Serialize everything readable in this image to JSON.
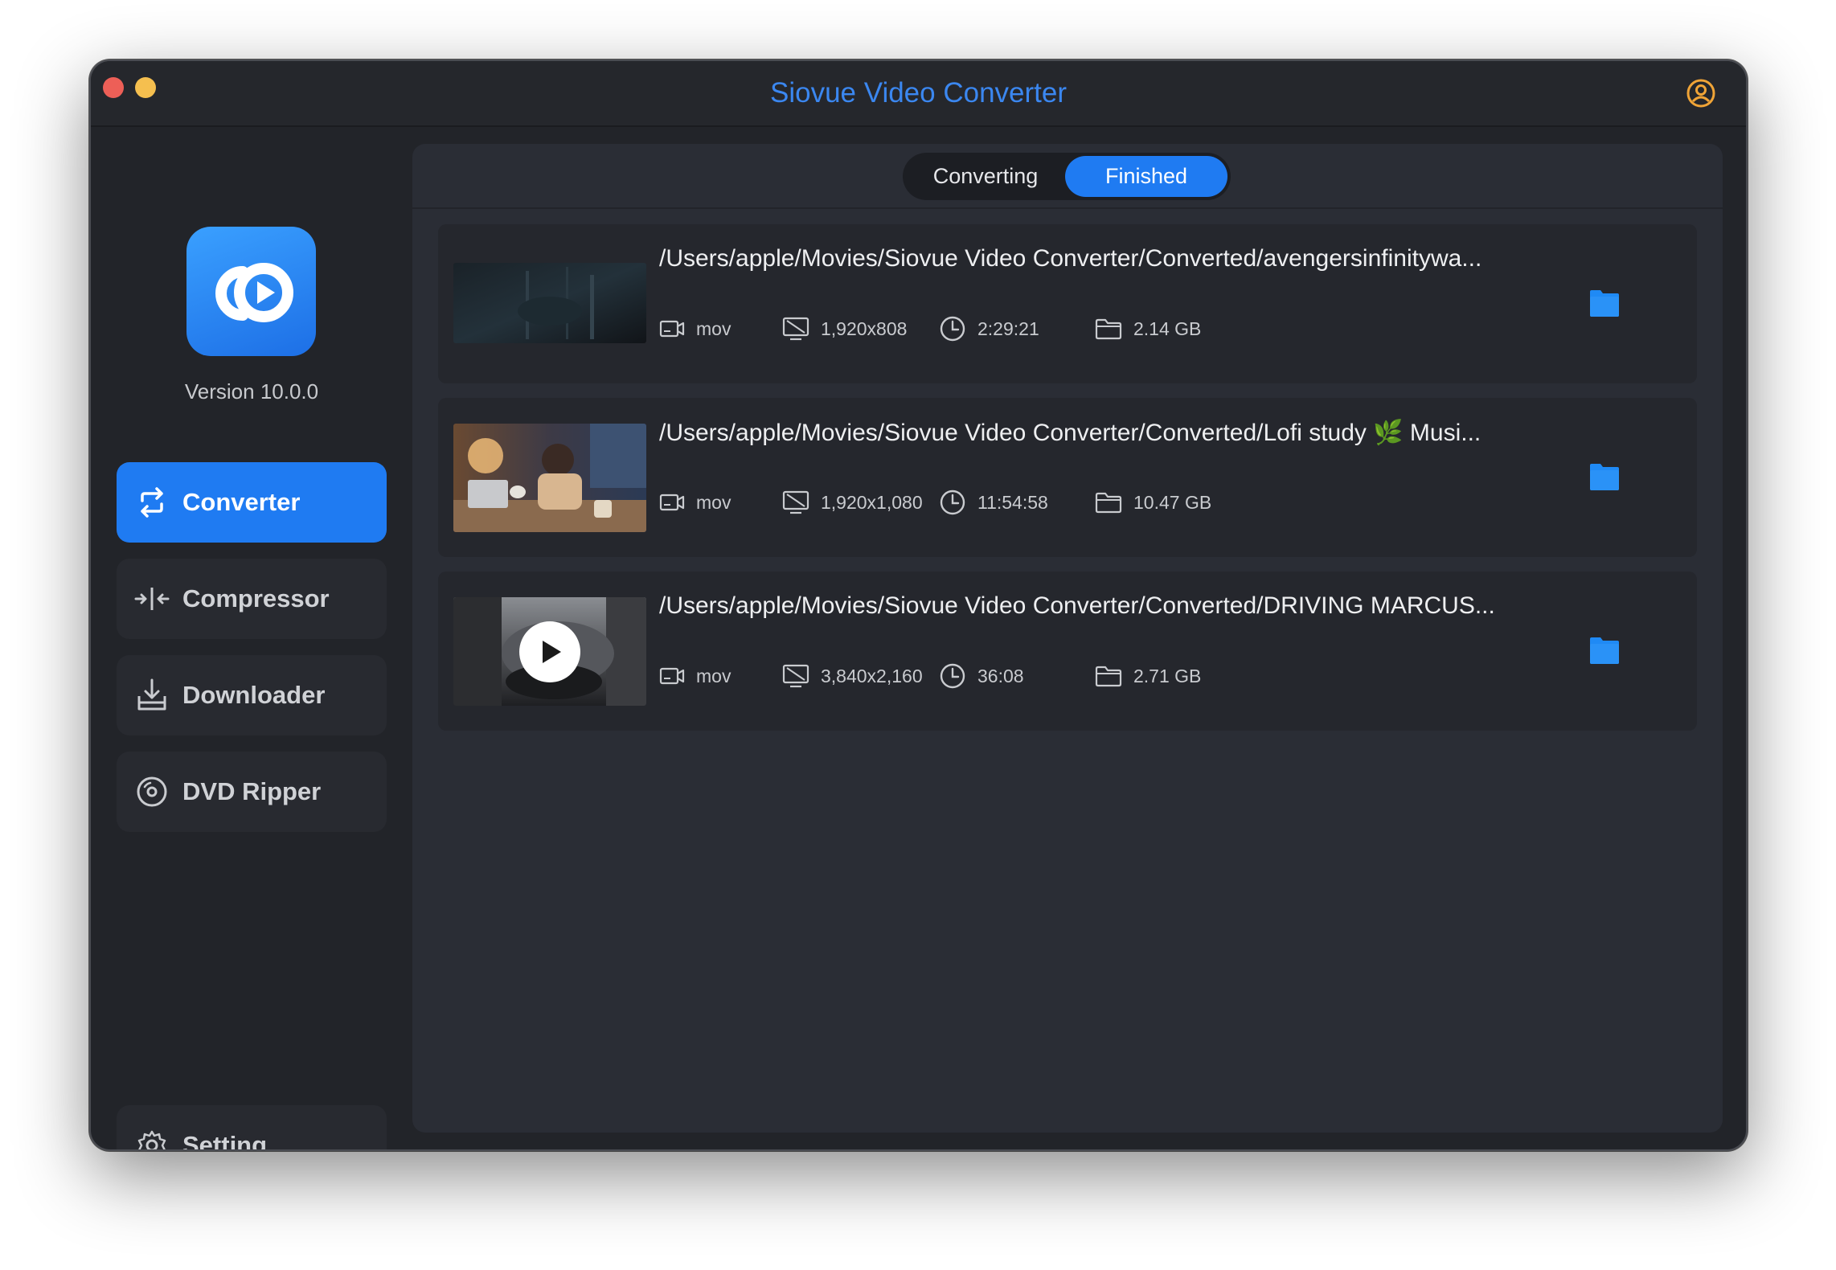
{
  "window": {
    "title": "Siovue Video Converter",
    "accent": "#1f7bf2"
  },
  "sidebar": {
    "version": "Version 10.0.0",
    "items": [
      {
        "label": "Converter",
        "icon": "convert-arrows-icon",
        "active": true
      },
      {
        "label": "Compressor",
        "icon": "compress-icon",
        "active": false
      },
      {
        "label": "Downloader",
        "icon": "download-tray-icon",
        "active": false
      },
      {
        "label": "DVD Ripper",
        "icon": "disc-icon",
        "active": false
      }
    ],
    "setting": {
      "label": "Setting",
      "icon": "gear-icon"
    }
  },
  "tabs": {
    "converting": "Converting",
    "finished": "Finished",
    "selected": "Finished"
  },
  "files": [
    {
      "path": "/Users/apple/Movies/Siovue Video Converter/Converted/avengersinfinitywa...",
      "format": "mov",
      "resolution": "1,920x808",
      "duration": "2:29:21",
      "size": "2.14 GB"
    },
    {
      "path": "/Users/apple/Movies/Siovue Video Converter/Converted/Lofi study 🌿 Musi...",
      "format": "mov",
      "resolution": "1,920x1,080",
      "duration": "11:54:58",
      "size": "10.47 GB"
    },
    {
      "path": "/Users/apple/Movies/Siovue Video Converter/Converted/DRIVING MARCUS...",
      "format": "mov",
      "resolution": "3,840x2,160",
      "duration": "36:08",
      "size": "2.71 GB"
    }
  ]
}
